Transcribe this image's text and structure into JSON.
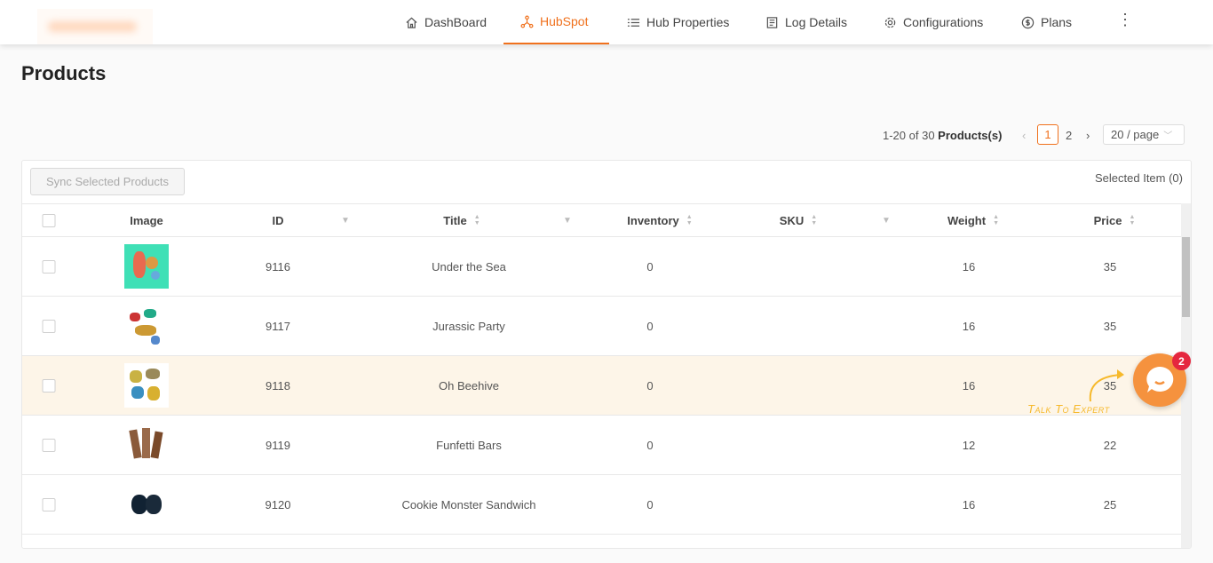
{
  "nav": [
    {
      "label": "DashBoard",
      "icon": "home-icon"
    },
    {
      "label": "HubSpot",
      "icon": "hubspot-icon",
      "active": true
    },
    {
      "label": "Hub Properties",
      "icon": "list-icon"
    },
    {
      "label": "Log Details",
      "icon": "document-icon"
    },
    {
      "label": "Configurations",
      "icon": "gear-icon"
    },
    {
      "label": "Plans",
      "icon": "dollar-icon"
    }
  ],
  "page_title": "Products",
  "pagination": {
    "range": "1-20 of 30",
    "unit": "Products(s)",
    "pages": [
      "1",
      "2"
    ],
    "current": "1",
    "page_size": "20 / page"
  },
  "toolbar": {
    "sync_label": "Sync Selected Products",
    "selected": "Selected Item (0)"
  },
  "columns": [
    "Image",
    "ID",
    "Title",
    "Inventory",
    "SKU",
    "Weight",
    "Price"
  ],
  "rows": [
    {
      "id": "9116",
      "title": "Under the Sea",
      "inventory": "0",
      "sku": "",
      "weight": "16",
      "price": "35"
    },
    {
      "id": "9117",
      "title": "Jurassic Party",
      "inventory": "0",
      "sku": "",
      "weight": "16",
      "price": "35"
    },
    {
      "id": "9118",
      "title": "Oh Beehive",
      "inventory": "0",
      "sku": "",
      "weight": "16",
      "price": "35"
    },
    {
      "id": "9119",
      "title": "Funfetti Bars",
      "inventory": "0",
      "sku": "",
      "weight": "12",
      "price": "22"
    },
    {
      "id": "9120",
      "title": "Cookie Monster Sandwich",
      "inventory": "0",
      "sku": "",
      "weight": "16",
      "price": "25"
    }
  ],
  "chat": {
    "badge": "2",
    "label": "Talk To Expert"
  },
  "colors": {
    "accent": "#f0711d",
    "highlight_row": "#fdf5e8",
    "chat": "#f5923e",
    "badge": "#e5273f"
  }
}
